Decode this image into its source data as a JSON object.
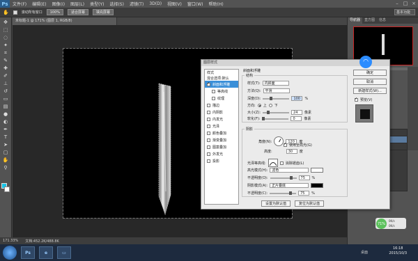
{
  "app": {
    "logo": "Ps"
  },
  "menu": [
    "文件(F)",
    "编辑(E)",
    "图像(I)",
    "图层(L)",
    "类型(Y)",
    "选择(S)",
    "滤镜(T)",
    "3D(D)",
    "视图(V)",
    "窗口(W)",
    "帮助(H)"
  ],
  "options": {
    "scroll_all": "滚动所有窗口",
    "btn_100": "100%",
    "btn_fit": "适合屏幕",
    "btn_fill": "填充屏幕",
    "workspace": "基本功能"
  },
  "document": {
    "tab": "未标题-1 @ 171% (图层 1, RGB/8)",
    "zoom": "171.33%",
    "doc_size": "文档:452.2K/488.8K"
  },
  "panels": {
    "tabs": [
      "导航器",
      "直方图",
      "信息"
    ]
  },
  "dialog": {
    "title": "图层样式",
    "list_header": "样式",
    "blend_default": "混合选项:默认",
    "styles": [
      {
        "label": "斜面和浮雕",
        "checked": true,
        "selected": true,
        "sub": false
      },
      {
        "label": "等高线",
        "checked": false,
        "selected": false,
        "sub": true
      },
      {
        "label": "纹理",
        "checked": false,
        "selected": false,
        "sub": true
      },
      {
        "label": "描边",
        "checked": false,
        "selected": false,
        "sub": false
      },
      {
        "label": "内阴影",
        "checked": false,
        "selected": false,
        "sub": false
      },
      {
        "label": "内发光",
        "checked": false,
        "selected": false,
        "sub": false
      },
      {
        "label": "光泽",
        "checked": false,
        "selected": false,
        "sub": false
      },
      {
        "label": "颜色叠加",
        "checked": false,
        "selected": false,
        "sub": false
      },
      {
        "label": "渐变叠加",
        "checked": false,
        "selected": false,
        "sub": false
      },
      {
        "label": "图案叠加",
        "checked": false,
        "selected": false,
        "sub": false
      },
      {
        "label": "外发光",
        "checked": false,
        "selected": false,
        "sub": false
      },
      {
        "label": "投影",
        "checked": false,
        "selected": false,
        "sub": false
      }
    ],
    "bevel": {
      "section": "斜面和浮雕",
      "structure": "结构",
      "style_label": "样式(T):",
      "style_value": "内斜面",
      "technique_label": "方法(Q):",
      "technique_value": "平滑",
      "depth_label": "深度(D):",
      "depth_value": "100",
      "pct": "%",
      "direction_label": "方向:",
      "dir_up": "上",
      "dir_down": "下",
      "size_label": "大小(Z):",
      "size_value": "24",
      "px": "像素",
      "soften_label": "软化(F):",
      "soften_value": "0",
      "shading": "阴影",
      "angle_label": "角度(N):",
      "angle_value": "120",
      "deg": "度",
      "global_light": "使用全局光(G)",
      "altitude_label": "高度:",
      "altitude_value": "30",
      "gloss_label": "光泽等高线:",
      "anti_alias": "消除锯齿(L)",
      "highlight_label": "高光模式(H):",
      "highlight_value": "滤色",
      "hl_opacity_label": "不透明度(O):",
      "hl_opacity_value": "75",
      "shadow_label": "阴影模式(A):",
      "shadow_value": "正片叠底",
      "sh_opacity_label": "不透明度(C):",
      "sh_opacity_value": "75",
      "make_default": "设置为默认值",
      "reset_default": "复位为默认值"
    },
    "buttons": {
      "ok": "确定",
      "cancel": "取消",
      "new_style": "新建样式(W)...",
      "preview": "预览(V)"
    }
  },
  "taskbar": {
    "ps": "Ps",
    "time": "16:18",
    "date": "2015/10/3",
    "desktop": "桌面"
  },
  "widget": {
    "pct": "71%",
    "up": "0K/s",
    "down": "0K/s"
  }
}
